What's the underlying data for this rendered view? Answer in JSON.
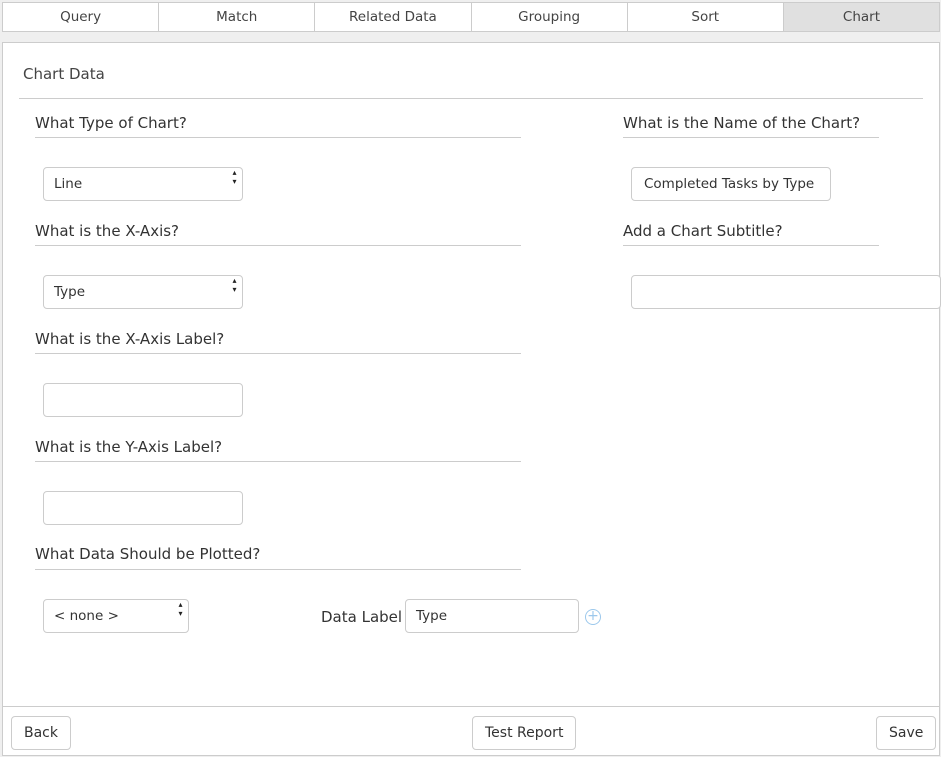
{
  "tabs": [
    "Query",
    "Match",
    "Related Data",
    "Grouping",
    "Sort",
    "Chart"
  ],
  "active_tab": "Chart",
  "section_title": "Chart Data",
  "chart_type": {
    "question": "What Type of Chart?",
    "value": "Line"
  },
  "x_axis": {
    "question": "What is the X-Axis?",
    "value": "Type"
  },
  "x_axis_label": {
    "question": "What is the X-Axis Label?",
    "value": ""
  },
  "y_axis_label": {
    "question": "What is the Y-Axis Label?",
    "value": ""
  },
  "plot_data": {
    "question": "What Data Should be Plotted?",
    "value": "< none >",
    "data_label_text": "Data Label",
    "data_label_value": "Type",
    "add_icon": "plus-circle-icon"
  },
  "chart_name": {
    "question": "What is the Name of the Chart?",
    "value": "Completed Tasks by Type"
  },
  "chart_subtitle": {
    "question": "Add a Chart Subtitle?",
    "value": ""
  },
  "buttons": {
    "back": "Back",
    "test": "Test Report",
    "save": "Save"
  }
}
